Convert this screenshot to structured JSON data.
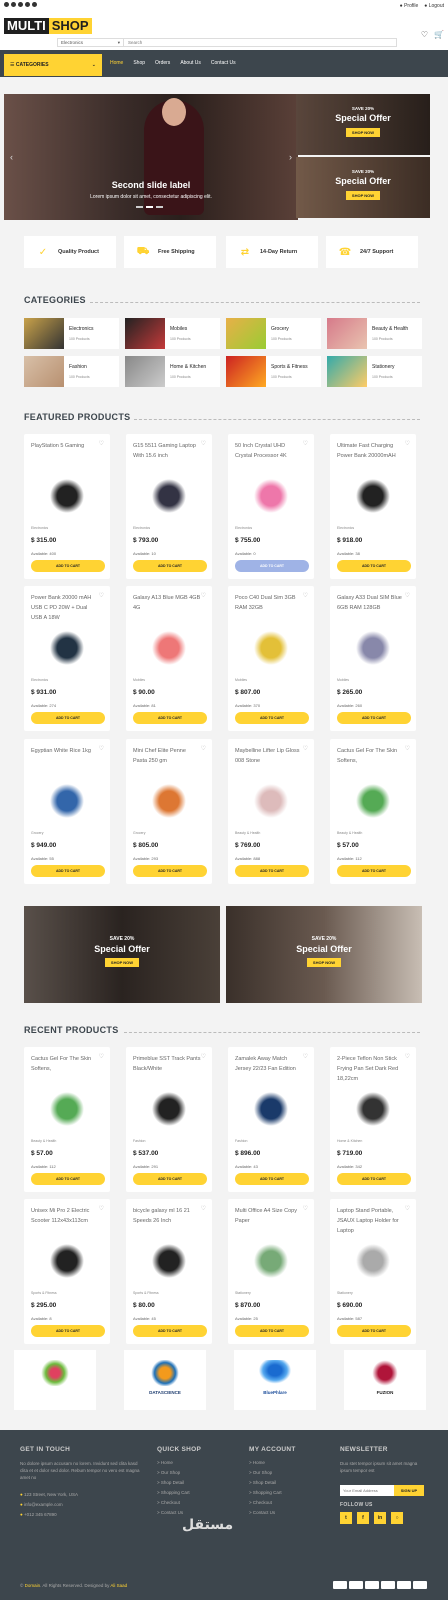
{
  "topbar": {
    "profile": "Profile",
    "logout": "Logout"
  },
  "logo": {
    "part1": "MULTI",
    "part2": "SHOP"
  },
  "search": {
    "category": "Electronics",
    "placeholder": "Search"
  },
  "nav": {
    "categories": "CATEGORIES",
    "links": [
      "Home",
      "Shop",
      "Orders",
      "About Us",
      "Contact Us"
    ]
  },
  "carousel": {
    "title": "Second slide label",
    "subtitle": "Lorem ipsum dolor sit amet, consectetur adipiscing elit."
  },
  "side_offers": [
    {
      "pct": "SAVE 20%",
      "title": "Special Offer",
      "button": "SHOP NOW"
    },
    {
      "pct": "SAVE 20%",
      "title": "Special Offer",
      "button": "SHOP NOW"
    }
  ],
  "features": [
    "Quality Product",
    "Free Shipping",
    "14-Day Return",
    "24/7 Support"
  ],
  "categories_title": "CATEGORIES",
  "categories": [
    {
      "name": "Electronics",
      "count": "100 Products"
    },
    {
      "name": "Mobiles",
      "count": "100 Products"
    },
    {
      "name": "Grocery",
      "count": "100 Products"
    },
    {
      "name": "Beauty & Health",
      "count": "100 Products"
    },
    {
      "name": "Fashion",
      "count": "100 Products"
    },
    {
      "name": "Home & Kitchen",
      "count": "100 Products"
    },
    {
      "name": "Sports & Fitness",
      "count": "100 Products"
    },
    {
      "name": "Stationery",
      "count": "100 Products"
    }
  ],
  "featured_title": "FEATURED PRODUCTS",
  "featured": [
    {
      "name": "PlayStation 5 Gaming",
      "cat": "Electronics",
      "price": "$ 315.00",
      "avail": "Available: 400",
      "btn": "ADD TO CART",
      "disabled": false
    },
    {
      "name": "G15 5511 Gaming Laptop With 15.6 inch",
      "cat": "Electronics",
      "price": "$ 793.00",
      "avail": "Available: 10",
      "btn": "ADD TO CART",
      "disabled": false
    },
    {
      "name": "50 Inch Crystal UHD Crystal Processor 4K",
      "cat": "Electronics",
      "price": "$ 755.00",
      "avail": "Available: 0",
      "btn": "ADD TO CART",
      "disabled": true
    },
    {
      "name": "Ultimate Fast Charging Power Bank 20000mAH",
      "cat": "Electronics",
      "price": "$ 918.00",
      "avail": "Available: 38",
      "btn": "ADD TO CART",
      "disabled": false
    },
    {
      "name": "Power Bank 20000 mAH USB C PD 20W + Dual USB A 18W",
      "cat": "Electronics",
      "price": "$ 931.00",
      "avail": "Available: 274",
      "btn": "ADD TO CART",
      "disabled": false
    },
    {
      "name": "Galaxy A13 Blue MGB 4GB 4G",
      "cat": "Mobiles",
      "price": "$ 90.00",
      "avail": "Available: 81",
      "btn": "ADD TO CART",
      "disabled": false
    },
    {
      "name": "Poco C40 Dual Sim 3GB RAM 32GB",
      "cat": "Mobiles",
      "price": "$ 807.00",
      "avail": "Available: 370",
      "btn": "ADD TO CART",
      "disabled": false
    },
    {
      "name": "Galaxy A33 Dual SIM Blue 6GB RAM 128GB",
      "cat": "Mobiles",
      "price": "$ 265.00",
      "avail": "Available: 260",
      "btn": "ADD TO CART",
      "disabled": false
    },
    {
      "name": "Egyptian White Rice 1kg",
      "cat": "Grocery",
      "price": "$ 949.00",
      "avail": "Available: 55",
      "btn": "ADD TO CART",
      "disabled": false
    },
    {
      "name": "Mini Chef Elite Penne Pasta 250 gm",
      "cat": "Grocery",
      "price": "$ 805.00",
      "avail": "Available: 293",
      "btn": "ADD TO CART",
      "disabled": false
    },
    {
      "name": "Maybelline Lifter Lip Gloss 008 Stone",
      "cat": "Beauty & Health",
      "price": "$ 769.00",
      "avail": "Available: 888",
      "btn": "ADD TO CART",
      "disabled": false
    },
    {
      "name": "Cactus Gel For The Skin Softens,",
      "cat": "Beauty & Health",
      "price": "$ 57.00",
      "avail": "Available: 112",
      "btn": "ADD TO CART",
      "disabled": false
    }
  ],
  "big_offers": [
    {
      "pct": "SAVE 20%",
      "title": "Special Offer",
      "button": "SHOP NOW"
    },
    {
      "pct": "SAVE 20%",
      "title": "Special Offer",
      "button": "SHOP NOW"
    }
  ],
  "recent_title": "RECENT PRODUCTS",
  "recent": [
    {
      "name": "Cactus Gel For The Skin Softens,",
      "cat": "Beauty & Health",
      "price": "$ 57.00",
      "avail": "Available: 112",
      "btn": "ADD TO CART"
    },
    {
      "name": "Primeblue SST Track Pants Black/White",
      "cat": "Fashion",
      "price": "$ 537.00",
      "avail": "Available: 291",
      "btn": "ADD TO CART"
    },
    {
      "name": "Zamalek Away Match Jersey 22/23 Fan Edition",
      "cat": "Fashion",
      "price": "$ 896.00",
      "avail": "Available: 43",
      "btn": "ADD TO CART"
    },
    {
      "name": "2-Piece Teflon Non Stick Frying Pan Set Dark Red 18,22cm",
      "cat": "Home & Kitchen",
      "price": "$ 719.00",
      "avail": "Available: 342",
      "btn": "ADD TO CART"
    },
    {
      "name": "Unisex Mi Pro 2 Electric Scooter 112x43x113cm",
      "cat": "Sports & Fitness",
      "price": "$ 295.00",
      "avail": "Available: 8",
      "btn": "ADD TO CART"
    },
    {
      "name": "bicycle galaxy ml 16 21 Speeds 26 Inch",
      "cat": "Sports & Fitness",
      "price": "$ 80.00",
      "avail": "Available: 45",
      "btn": "ADD TO CART"
    },
    {
      "name": "Multi Office A4 Size Copy Paper",
      "cat": "Stationery",
      "price": "$ 870.00",
      "avail": "Available: 25",
      "btn": "ADD TO CART"
    },
    {
      "name": "Laptop Stand Portable, JSAUX Laptop Holder for Laptop",
      "cat": "Stationery",
      "price": "$ 690.00",
      "avail": "Available: 587",
      "btn": "ADD TO CART"
    }
  ],
  "vendors": [
    "DATASCIENCE",
    "BluePhlare",
    "FUZION"
  ],
  "footer": {
    "get_in_touch": "GET IN TOUCH",
    "about": "No dolore ipsum accusam no lorem. Invidunt sed clita kasd clita et et dolor sed dolor. Rebum tempor no vero est magna amet no",
    "address": "123 Street, New York, USA",
    "email": "info@example.com",
    "phone": "+012 345 67890",
    "quick_shop": "QUICK SHOP",
    "quick_links": [
      "Home",
      "Our Shop",
      "Shop Detail",
      "Shopping Cart",
      "Checkout",
      "Contact Us"
    ],
    "my_account": "MY ACCOUNT",
    "account_links": [
      "Home",
      "Our Shop",
      "Shop Detail",
      "Shopping Cart",
      "Checkout",
      "Contact Us"
    ],
    "newsletter": "NEWSLETTER",
    "newsletter_text": "Duo stet tempor ipsum sit amet magna ipsum tempor est",
    "email_placeholder": "Your Email Address",
    "signup": "SIGN UP",
    "follow": "FOLLOW US",
    "copyright_brand": "Domain",
    "copyright": ". All Rights Reserved. Designed by",
    "designer": "Ali Saad"
  },
  "watermark": "مستقل",
  "colors": {
    "accent": "#ffd333",
    "dark": "#3d464d"
  }
}
